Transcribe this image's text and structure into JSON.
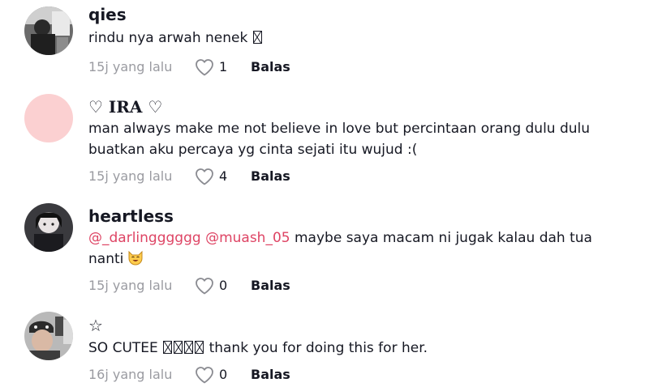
{
  "comments": [
    {
      "username": "qies",
      "text": "rindu nya arwah nenek",
      "time": "15j yang lalu",
      "likes": "1",
      "reply_label": "Balas"
    },
    {
      "username": "♡ IRA ♡",
      "text": "man always make me not believe in love but percintaan orang dulu dulu buatkan aku percaya yg cinta sejati itu wujud :(",
      "time": "15j yang lalu",
      "likes": "4",
      "reply_label": "Balas"
    },
    {
      "username": "heartless",
      "mention1": "@_darlingggggg",
      "mention2": "@muash_05",
      "text": " maybe saya macam ni jugak kalau dah tua nanti",
      "time": "15j yang lalu",
      "likes": "0",
      "reply_label": "Balas"
    },
    {
      "username": "☆",
      "text_before": "SO CUTEE",
      "text_after": "thank you for doing this for her.",
      "time": "16j yang lalu",
      "likes": "0",
      "reply_label": "Balas"
    }
  ],
  "colors": {
    "text": "#161823",
    "muted": "#9a9ba1",
    "mention": "#de4464",
    "avatar_pink": "#fbd0d1"
  },
  "icons": {
    "like": "heart-outline-icon",
    "emoji_unsupported": "missing-glyph-box-icon",
    "emoji_cat": "smiling-cat-emoji-icon"
  }
}
